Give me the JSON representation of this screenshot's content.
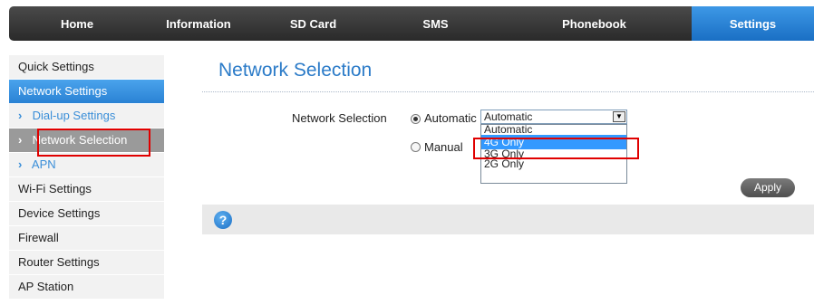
{
  "topnav": {
    "items": [
      {
        "label": "Home"
      },
      {
        "label": "Information"
      },
      {
        "label": "SD Card"
      },
      {
        "label": "SMS"
      },
      {
        "label": "Phonebook"
      },
      {
        "label": "Settings",
        "active": true
      }
    ]
  },
  "sidebar": {
    "quick_settings": "Quick Settings",
    "network_settings": "Network Settings",
    "sub_dialup": "Dial-up Settings",
    "sub_network_selection": "Network Selection",
    "sub_apn": "APN",
    "wifi_settings": "Wi-Fi Settings",
    "device_settings": "Device Settings",
    "firewall": "Firewall",
    "router_settings": "Router Settings",
    "ap_station": "AP Station",
    "chevron": "›"
  },
  "main": {
    "title": "Network Selection",
    "field_label": "Network Selection",
    "radio_automatic": "Automatic",
    "radio_manual": "Manual",
    "select_value": "Automatic",
    "options": [
      "Automatic",
      "4G Only",
      "3G Only",
      "2G Only"
    ],
    "selected_option_index": 1,
    "apply_label": "Apply",
    "help_glyph": "?"
  },
  "colors": {
    "accent": "#2b7bc8",
    "highlight_box": "#e00000",
    "selected_option": "#3399ff"
  },
  "icons": [
    "chevron-right-icon",
    "help-icon",
    "dropdown-arrow-icon",
    "radio-icon"
  ]
}
